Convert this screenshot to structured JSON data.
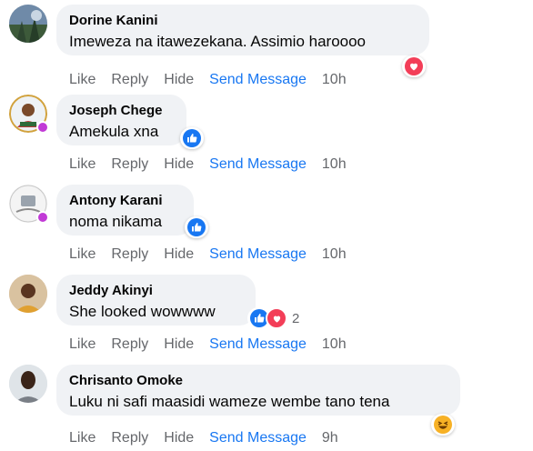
{
  "colors": {
    "bubble": "#f0f2f5",
    "accent": "#1877f2",
    "muted": "#65676b",
    "love": "#f33e58",
    "haha": "#f7b125"
  },
  "actions": {
    "like": "Like",
    "reply": "Reply",
    "hide": "Hide",
    "send": "Send Message"
  },
  "comments": [
    {
      "author": "Dorine Kanini",
      "text": "Imeweza na itawezekana. Assimio haroooo",
      "time": "10h",
      "reactions": [
        "love"
      ]
    },
    {
      "author": "Joseph Chege",
      "text": "Amekula xna",
      "time": "10h",
      "reactions": [
        "like"
      ]
    },
    {
      "author": "Antony Karani",
      "text": "noma nikama",
      "time": "10h",
      "reactions": [
        "like"
      ]
    },
    {
      "author": "Jeddy Akinyi",
      "text": "She looked wowwww",
      "time": "10h",
      "reactions": [
        "like",
        "love"
      ],
      "reaction_count": "2"
    },
    {
      "author": "Chrisanto Omoke",
      "text": "Luku ni safi maasidi wameze wembe tano tena",
      "time": "9h",
      "reactions": [
        "haha"
      ]
    }
  ]
}
